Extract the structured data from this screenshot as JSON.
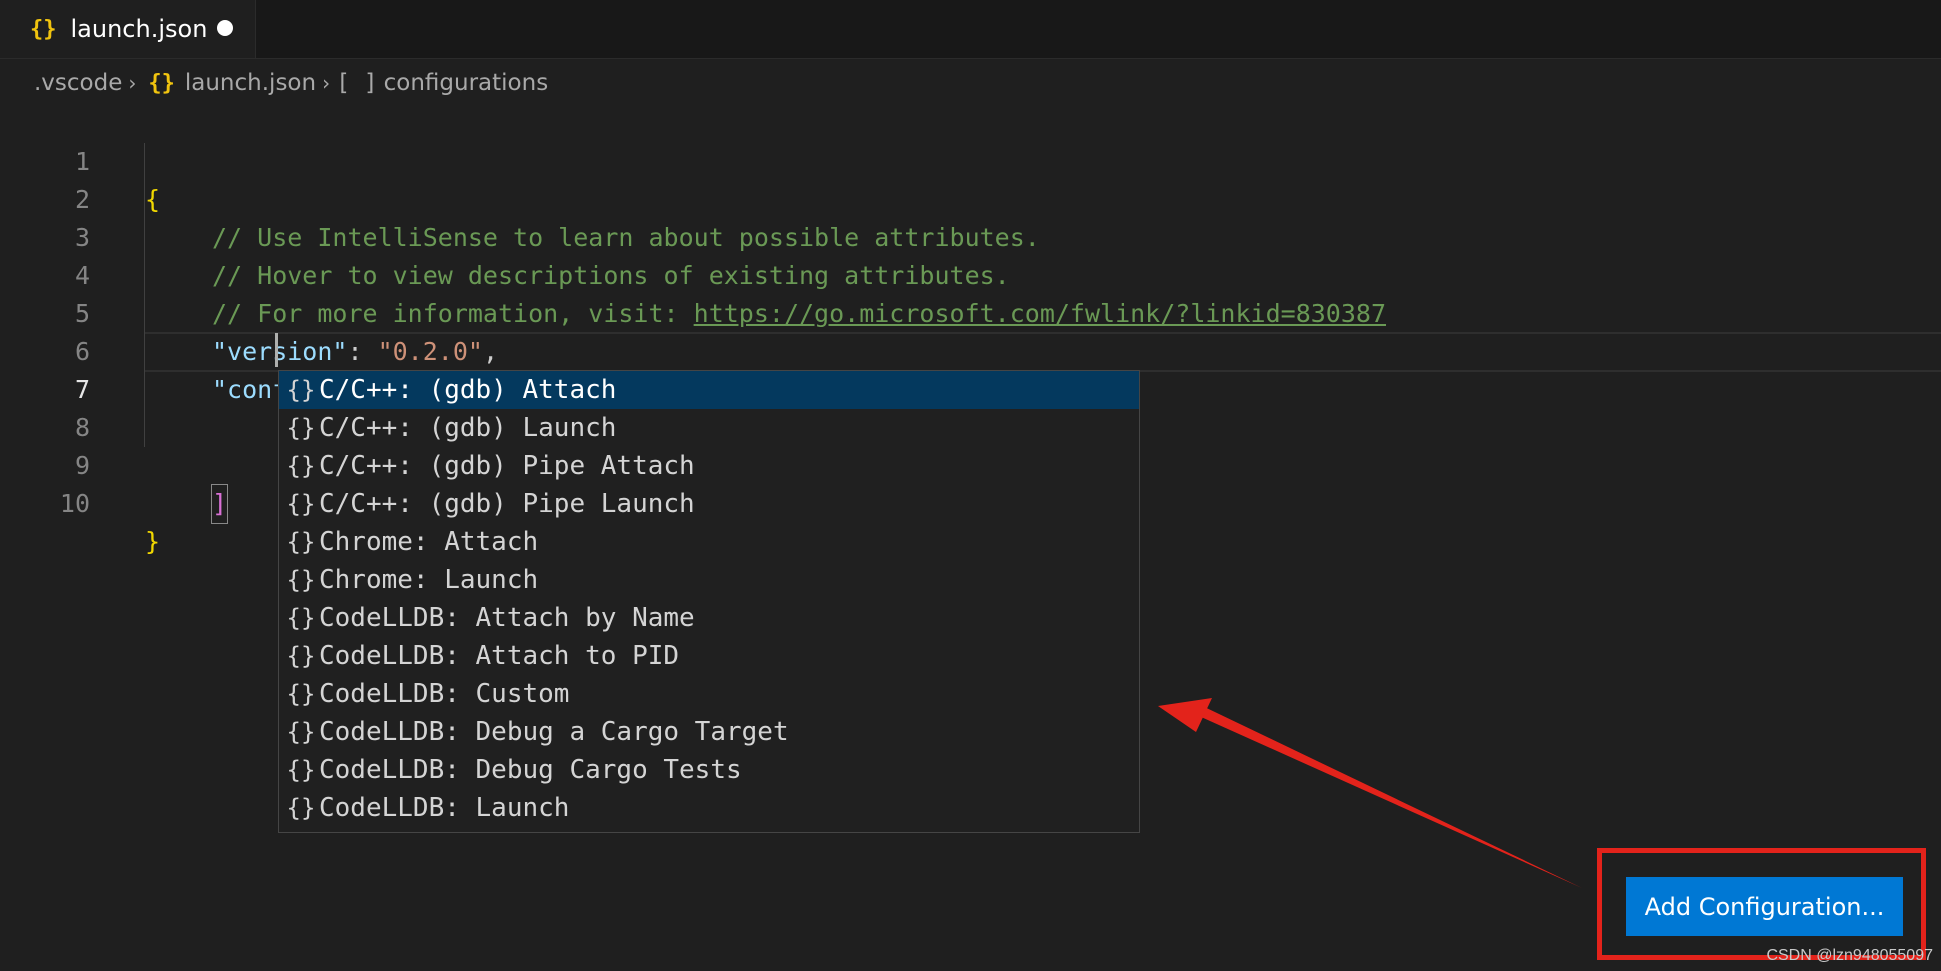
{
  "tab": {
    "icon": "{}",
    "icon_name": "json-file-icon",
    "label": "launch.json",
    "dirty": true
  },
  "breadcrumb": {
    "folder": ".vscode",
    "file_icon": "{}",
    "file": "launch.json",
    "array_icon": "[ ]",
    "symbol": "configurations"
  },
  "editor": {
    "current_line": 7,
    "lines": [
      {
        "n": "1"
      },
      {
        "n": "2"
      },
      {
        "n": "3"
      },
      {
        "n": "4"
      },
      {
        "n": "5"
      },
      {
        "n": "6"
      },
      {
        "n": "7"
      },
      {
        "n": "8"
      },
      {
        "n": "9"
      },
      {
        "n": "10"
      }
    ],
    "code": {
      "open_brace": "{",
      "comment1": "// Use IntelliSense to learn about possible attributes.",
      "comment2": "// Hover to view descriptions of existing attributes.",
      "comment3_prefix": "// For more information, visit: ",
      "comment3_link": "https://go.microsoft.com/fwlink/?linkid=830387",
      "version_key": "\"version\"",
      "version_colon": ": ",
      "version_value": "\"0.2.0\"",
      "version_comma": ",",
      "config_key": "\"configurations\"",
      "config_colon": ": ",
      "open_bracket": "[",
      "close_bracket": "]",
      "close_brace": "}"
    }
  },
  "suggest": {
    "icon": "{}",
    "selected_index": 0,
    "items": [
      "C/C++: (gdb) Attach",
      "C/C++: (gdb) Launch",
      "C/C++: (gdb) Pipe Attach",
      "C/C++: (gdb) Pipe Launch",
      "Chrome: Attach",
      "Chrome: Launch",
      "CodeLLDB: Attach by Name",
      "CodeLLDB: Attach to PID",
      "CodeLLDB: Custom",
      "CodeLLDB: Debug a Cargo Target",
      "CodeLLDB: Debug Cargo Tests",
      "CodeLLDB: Launch"
    ]
  },
  "add_config_button": {
    "label": "Add Configuration..."
  },
  "watermark": "CSDN @lzn948055097",
  "colors": {
    "accent_button": "#0078d4",
    "annotation_red": "#e3231b",
    "selection": "#04395e"
  }
}
